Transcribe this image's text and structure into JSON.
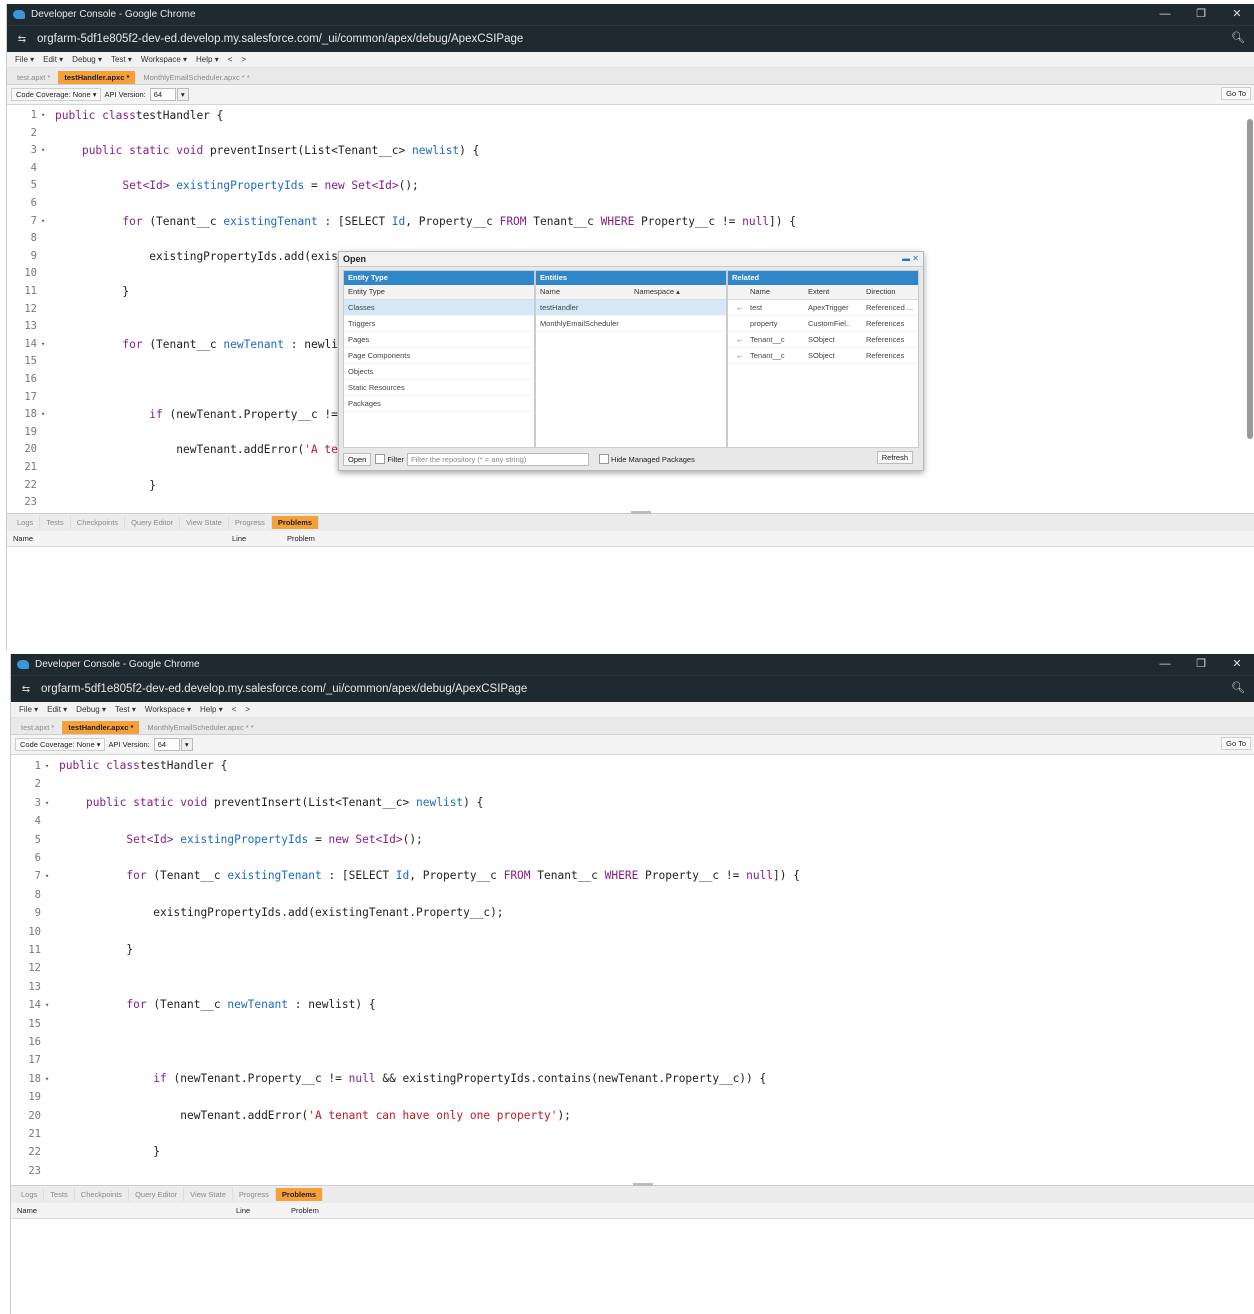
{
  "window": {
    "title": "Developer Console - Google Chrome",
    "url": "orgfarm-5df1e805f2-dev-ed.develop.my.salesforce.com/_ui/common/apex/debug/ApexCSIPage",
    "controls": {
      "minimize": "—",
      "restore": "❐",
      "close": "✕"
    }
  },
  "menu": [
    "File ▾",
    "Edit ▾",
    "Debug ▾",
    "Test ▾",
    "Workspace ▾",
    "Help ▾",
    "<",
    ">"
  ],
  "tabs": [
    {
      "label": "test.apxt *",
      "active": false
    },
    {
      "label": "testHandler.apxc *",
      "active": true
    },
    {
      "label": "MonthlyEmailScheduler.apxc * *",
      "active": false
    }
  ],
  "toolbar": {
    "code_coverage": "Code Coverage: None ▾",
    "api_version_label": "API Version:",
    "api_version": "64",
    "goto": "Go To"
  },
  "code": [
    {
      "n": "1",
      "fold": "▾",
      "t": [
        [
          "kw",
          "public class"
        ],
        [
          "",
          "testHandler {"
        ]
      ]
    },
    {
      "n": "2",
      "fold": "",
      "t": []
    },
    {
      "n": "3",
      "fold": "▾",
      "t": [
        [
          "",
          "    "
        ],
        [
          "kw",
          "public static void"
        ],
        [
          "",
          " preventInsert(List<Tenant__c> "
        ],
        [
          "ty",
          "newlist"
        ],
        [
          "",
          ") {"
        ]
      ]
    },
    {
      "n": "4",
      "fold": "",
      "t": []
    },
    {
      "n": "5",
      "fold": "",
      "t": [
        [
          "",
          "          "
        ],
        [
          "kw",
          "Set<Id>"
        ],
        [
          "",
          " "
        ],
        [
          "ty",
          "existingPropertyIds"
        ],
        [
          "",
          " = "
        ],
        [
          "kw",
          "new"
        ],
        [
          "kw",
          " Set<Id>"
        ],
        [
          "",
          "();"
        ]
      ]
    },
    {
      "n": "6",
      "fold": "",
      "t": []
    },
    {
      "n": "7",
      "fold": "▾",
      "t": [
        [
          "",
          "          "
        ],
        [
          "kw",
          "for"
        ],
        [
          "",
          " (Tenant__c "
        ],
        [
          "ty",
          "existingTenant"
        ],
        [
          "",
          " : [SELECT "
        ],
        [
          "ty",
          "Id"
        ],
        [
          "",
          ", Property__c "
        ],
        [
          "kw",
          "FROM"
        ],
        [
          "",
          " Tenant__c "
        ],
        [
          "kw",
          "WHERE"
        ],
        [
          "",
          " Property__c != "
        ],
        [
          "kw",
          "null"
        ],
        [
          "",
          "]) {"
        ]
      ]
    },
    {
      "n": "8",
      "fold": "",
      "t": []
    },
    {
      "n": "9",
      "fold": "",
      "t": [
        [
          "",
          "              existingPropertyIds.add(existingTenant.Property__c);"
        ]
      ]
    },
    {
      "n": "10",
      "fold": "",
      "t": []
    },
    {
      "n": "11",
      "fold": "",
      "t": [
        [
          "",
          "          }"
        ]
      ]
    },
    {
      "n": "12",
      "fold": "",
      "t": []
    },
    {
      "n": "13",
      "fold": "",
      "t": []
    },
    {
      "n": "14",
      "fold": "▾",
      "t": [
        [
          "",
          "          "
        ],
        [
          "kw",
          "for"
        ],
        [
          "",
          " (Tenant__c "
        ],
        [
          "ty",
          "newTenant"
        ],
        [
          "",
          " : newlist) {"
        ]
      ]
    },
    {
      "n": "15",
      "fold": "",
      "t": []
    },
    {
      "n": "16",
      "fold": "",
      "t": []
    },
    {
      "n": "17",
      "fold": "",
      "t": []
    },
    {
      "n": "18",
      "fold": "▾",
      "t": [
        [
          "",
          "              "
        ],
        [
          "kw",
          "if"
        ],
        [
          "",
          " (newTenant.Property__c != "
        ],
        [
          "kw",
          "null"
        ],
        [
          "",
          " && existingPropertyIds.contains(newTenant.Property__c)) {"
        ]
      ]
    },
    {
      "n": "19",
      "fold": "",
      "t": []
    },
    {
      "n": "20",
      "fold": "",
      "t": [
        [
          "",
          "                  newTenant.addError("
        ],
        [
          "str",
          "'A tenant can have only one property'"
        ],
        [
          "",
          ");"
        ]
      ]
    },
    {
      "n": "21",
      "fold": "",
      "t": []
    },
    {
      "n": "22",
      "fold": "",
      "t": [
        [
          "",
          "              }"
        ]
      ]
    },
    {
      "n": "23",
      "fold": "",
      "t": []
    }
  ],
  "bottom_tabs": [
    {
      "label": "Logs",
      "active": false
    },
    {
      "label": "Tests",
      "active": false
    },
    {
      "label": "Checkpoints",
      "active": false
    },
    {
      "label": "Query Editor",
      "active": false
    },
    {
      "label": "View State",
      "active": false
    },
    {
      "label": "Progress",
      "active": false
    },
    {
      "label": "Problems",
      "active": true
    }
  ],
  "problems_columns": {
    "name": "Name",
    "line": "Line",
    "problem": "Problem"
  },
  "open_dialog": {
    "title": "Open",
    "controls": "▬ ✕",
    "entity_type": {
      "header": "Entity Type",
      "subheader": "Entity Type",
      "items": [
        "Classes",
        "Triggers",
        "Pages",
        "Page Components",
        "Objects",
        "Static Resources",
        "Packages"
      ],
      "selected": "Classes"
    },
    "entities": {
      "header": "Entities",
      "col_name": "Name",
      "col_namespace": "Namespace ▴",
      "items": [
        "testHandler",
        "MonthlyEmailScheduler"
      ],
      "selected": "testHandler"
    },
    "related": {
      "header": "Related",
      "col_name": "Name",
      "col_extent": "Extent",
      "col_direction": "Direction",
      "rows": [
        {
          "arrow": "←",
          "name": "test",
          "extent": "ApexTrigger",
          "direction": "Referenced ..."
        },
        {
          "arrow": "",
          "name": "property",
          "extent": "CustomFiel..",
          "direction": "References"
        },
        {
          "arrow": "←",
          "name": "Tenant__c",
          "extent": "SObject",
          "direction": "References"
        },
        {
          "arrow": "←",
          "name": "Tenant__c",
          "extent": "SObject",
          "direction": "References"
        }
      ]
    },
    "footer": {
      "open_button": "Open",
      "filter_label": "Filter",
      "filter_placeholder": "Filter the repository (* = any string)",
      "hide_managed": "Hide Managed Packages",
      "refresh": "Refresh"
    }
  }
}
